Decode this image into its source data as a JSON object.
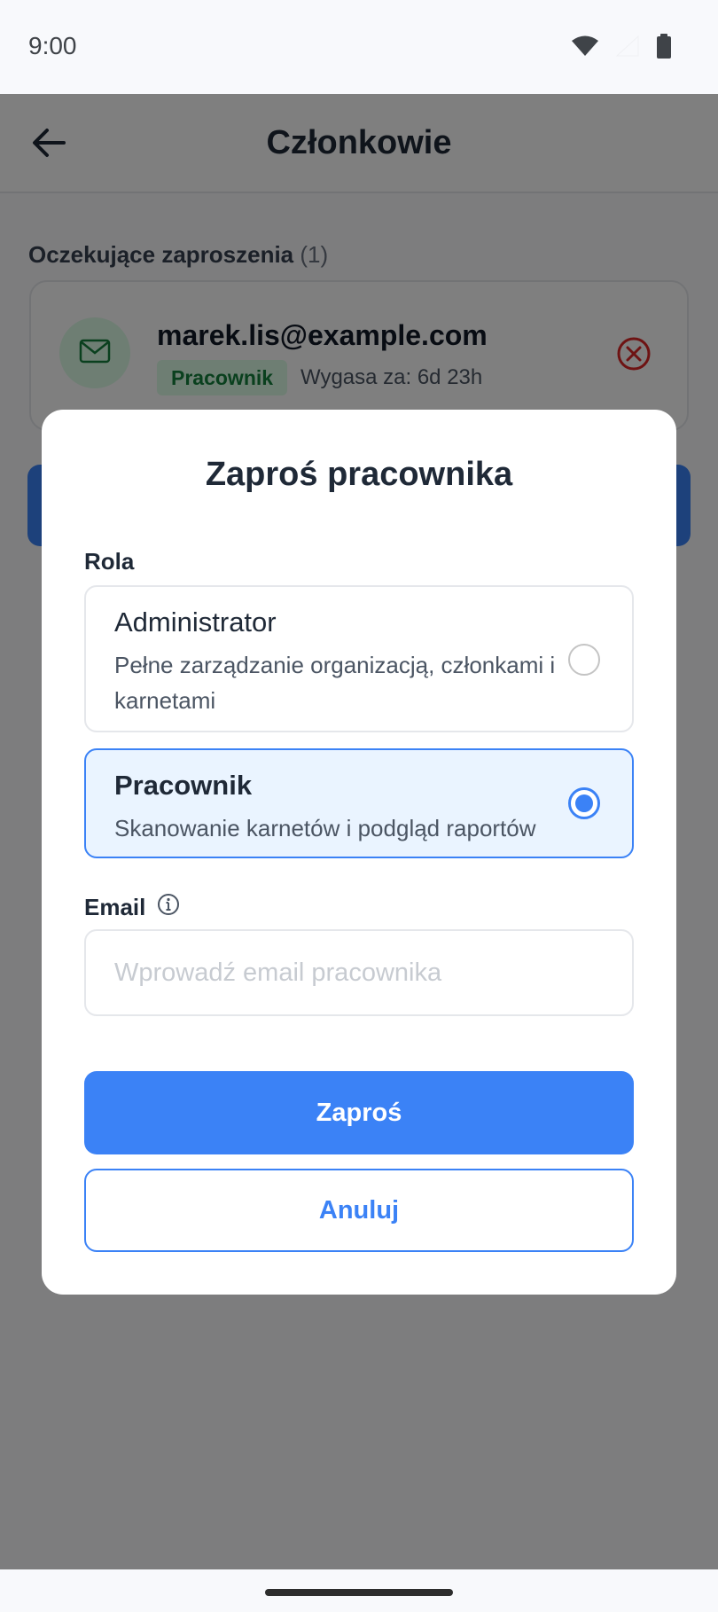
{
  "status_bar": {
    "time": "9:00",
    "icons": [
      "wifi-icon",
      "signal-icon",
      "battery-icon"
    ]
  },
  "app_bar": {
    "title": "Członkowie",
    "back_icon": "arrow-left-icon"
  },
  "pending_invites": {
    "title": "Oczekujące zaproszenia",
    "count": "(1)",
    "items": [
      {
        "email": "marek.lis@example.com",
        "role": "Pracownik",
        "expires": "Wygasa za: 6d 23h",
        "icon": "mail-icon",
        "cancel_icon": "close-circle-icon"
      }
    ]
  },
  "dialog": {
    "title": "Zaproś pracownika",
    "role_label": "Rola",
    "roles": [
      {
        "name": "Administrator",
        "description": "Pełne zarządzanie organizacją, członkami i karnetami",
        "selected": false
      },
      {
        "name": "Pracownik",
        "description": "Skanowanie karnetów i podgląd raportów",
        "selected": true
      }
    ],
    "email_label": "Email",
    "email_info_icon": "info-icon",
    "email_value": "",
    "email_placeholder": "Wprowadź email pracownika",
    "submit_label": "Zaproś",
    "cancel_label": "Anuluj"
  },
  "colors": {
    "primary": "#3b82f6",
    "success": "#15803d",
    "success_bg": "#dcfce7",
    "danger": "#dc2626"
  }
}
